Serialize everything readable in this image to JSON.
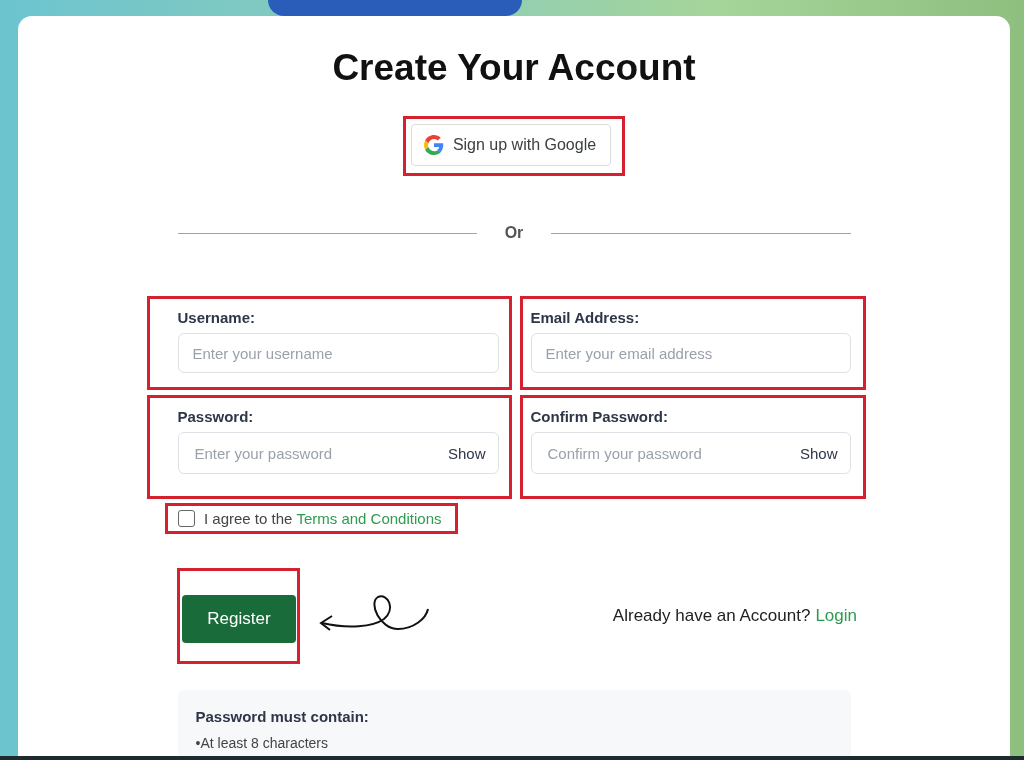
{
  "title": "Create Your Account",
  "google_button": {
    "label": "Sign up with Google"
  },
  "divider_text": "Or",
  "fields": [
    {
      "label": "Username:",
      "placeholder": "Enter your username"
    },
    {
      "label": "Email Address:",
      "placeholder": "Enter your email address"
    },
    {
      "label": "Password:",
      "placeholder": "Enter your password",
      "toggle": "Show"
    },
    {
      "label": "Confirm Password:",
      "placeholder": "Confirm your password",
      "toggle": "Show"
    }
  ],
  "terms": {
    "checked": false,
    "text": "I agree to the",
    "link": "Terms and Conditions"
  },
  "register_button": {
    "label": "Register"
  },
  "login": {
    "text": "Already have an Account?",
    "link": "Login"
  },
  "requirements": {
    "title": "Password must contain:",
    "items": [
      "•At least 8 characters"
    ]
  }
}
